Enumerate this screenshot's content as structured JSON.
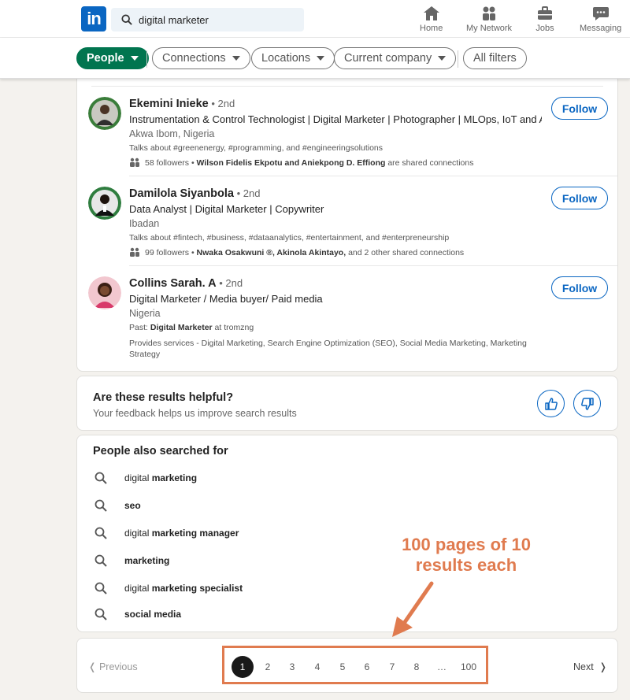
{
  "search": {
    "value": "digital marketer"
  },
  "nav": {
    "home": "Home",
    "network": "My Network",
    "jobs": "Jobs",
    "messaging": "Messaging"
  },
  "filters": {
    "people": "People",
    "connections": "Connections",
    "locations": "Locations",
    "company": "Current company",
    "all": "All filters"
  },
  "colors": {
    "brand": "#0a66c2",
    "active_filter": "#01754f",
    "annotation": "#e07b4f"
  },
  "results": [
    {
      "name": "Ekemini Inieke",
      "degree": " • 2nd",
      "headline": "Instrumentation & Control Technologist | Digital Marketer | Photographer | MLOps, IoT and AI ...",
      "location": "Akwa Ibom, Nigeria",
      "talks": "Talks about #greenenergy, #programming, and #engineeringsolutions",
      "followers": "58 followers • ",
      "connections": "Wilson Fidelis Ekpotu and Aniekpong D. Effiong",
      "connections_suffix": " are shared connections",
      "follow": "Follow"
    },
    {
      "name": "Damilola Siyanbola",
      "degree": " • 2nd",
      "headline": "Data Analyst | Digital Marketer | Copywriter",
      "location": "Ibadan",
      "talks": "Talks about #fintech, #business, #dataanalytics, #entertainment, and #enterpreneurship",
      "followers": "99 followers • ",
      "connections": "Nwaka Osakwuni ®, Akinola Akintayo,",
      "connections_suffix": " and 2 other shared connections",
      "follow": "Follow"
    },
    {
      "name": "Collins Sarah. A",
      "degree": " • 2nd",
      "headline": "Digital Marketer / Media buyer/ Paid media",
      "location": "Nigeria",
      "past_prefix": "Past: ",
      "past_role": "Digital Marketer",
      "past_suffix": " at tromzng",
      "services": "Provides services - Digital Marketing, Search Engine Optimization (SEO), Social Media Marketing, Marketing Strategy",
      "follow": "Follow"
    }
  ],
  "feedback": {
    "question": "Are these results helpful?",
    "sub": "Your feedback helps us improve search results"
  },
  "also": {
    "title": "People also searched for",
    "items": [
      {
        "pre": "digital ",
        "bold": "marketing",
        "post": ""
      },
      {
        "pre": "",
        "bold": "seo",
        "post": ""
      },
      {
        "pre": "digital ",
        "bold": "marketing manager",
        "post": ""
      },
      {
        "pre": "",
        "bold": "marketing",
        "post": ""
      },
      {
        "pre": "digital ",
        "bold": "marketing specialist",
        "post": ""
      },
      {
        "pre": "",
        "bold": "social media",
        "post": ""
      }
    ]
  },
  "pagination": {
    "previous": "Previous",
    "next": "Next",
    "pages": [
      "1",
      "2",
      "3",
      "4",
      "5",
      "6",
      "7",
      "8",
      "…",
      "100"
    ],
    "current": "1"
  },
  "annotation": {
    "line1": "100 pages of 10",
    "line2": "results each"
  }
}
